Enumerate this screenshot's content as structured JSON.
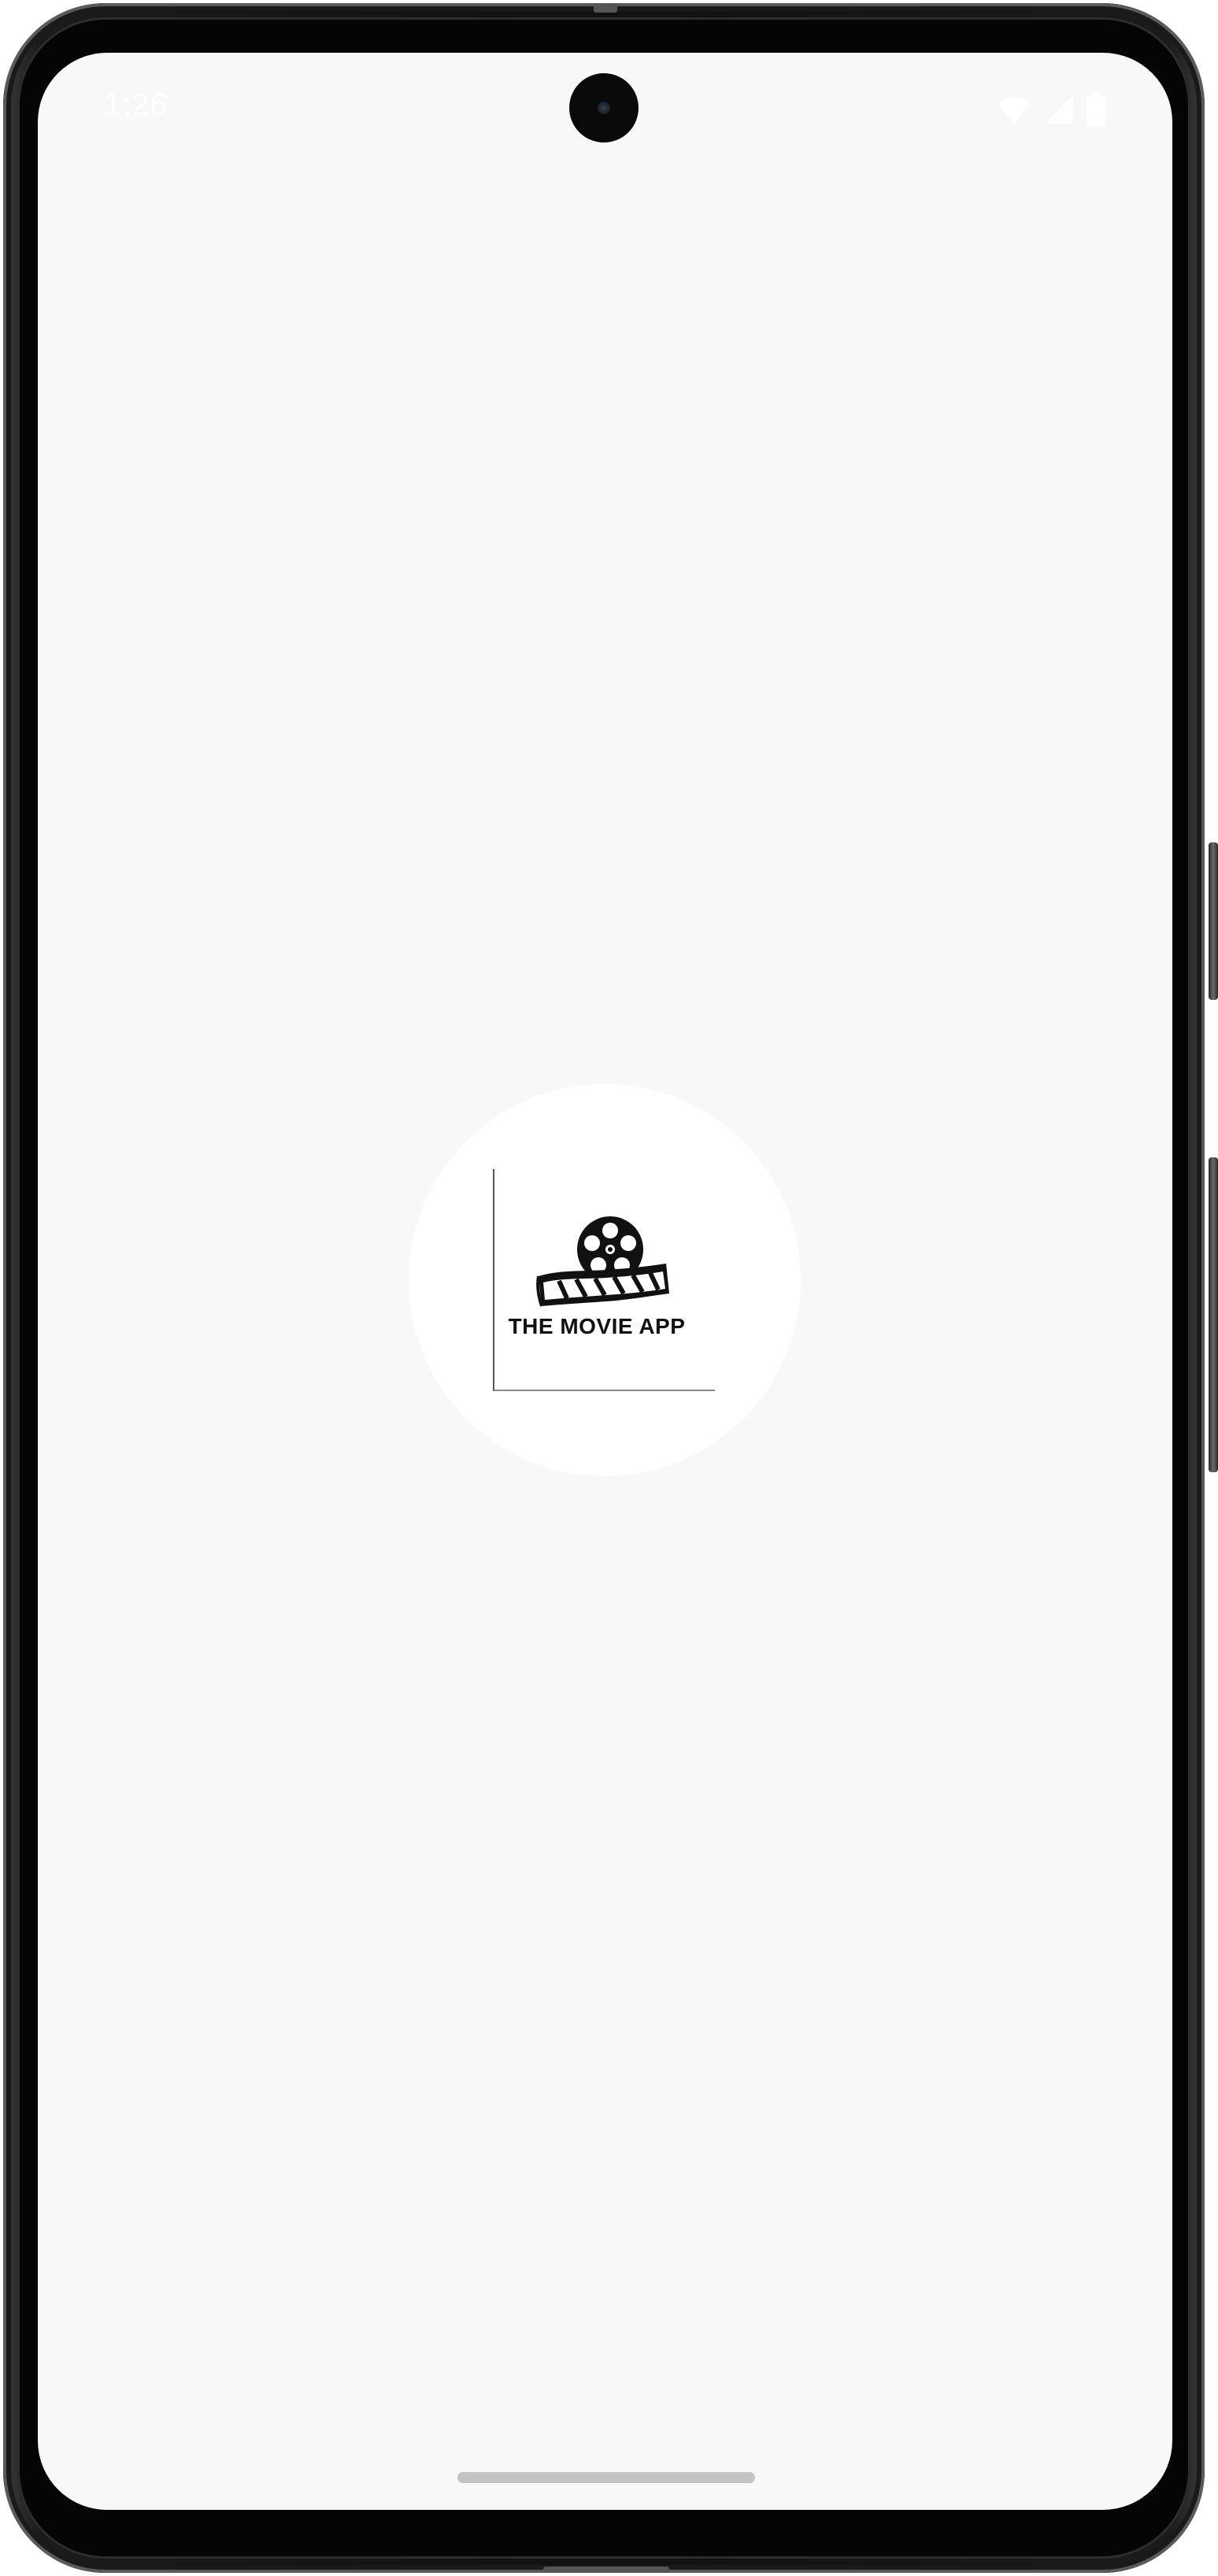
{
  "status_bar": {
    "time": "1:26",
    "icons": [
      "wifi-icon",
      "cellular-signal-icon",
      "battery-icon"
    ]
  },
  "splash": {
    "logo_icon": "film-reel-icon",
    "logo_text": "THE MOVIE APP"
  },
  "colors": {
    "screen_background": "#f8f8f8",
    "logo_circle": "#ffffff",
    "logo_ink": "#111111",
    "nav_handle": "#c4c4c4"
  }
}
